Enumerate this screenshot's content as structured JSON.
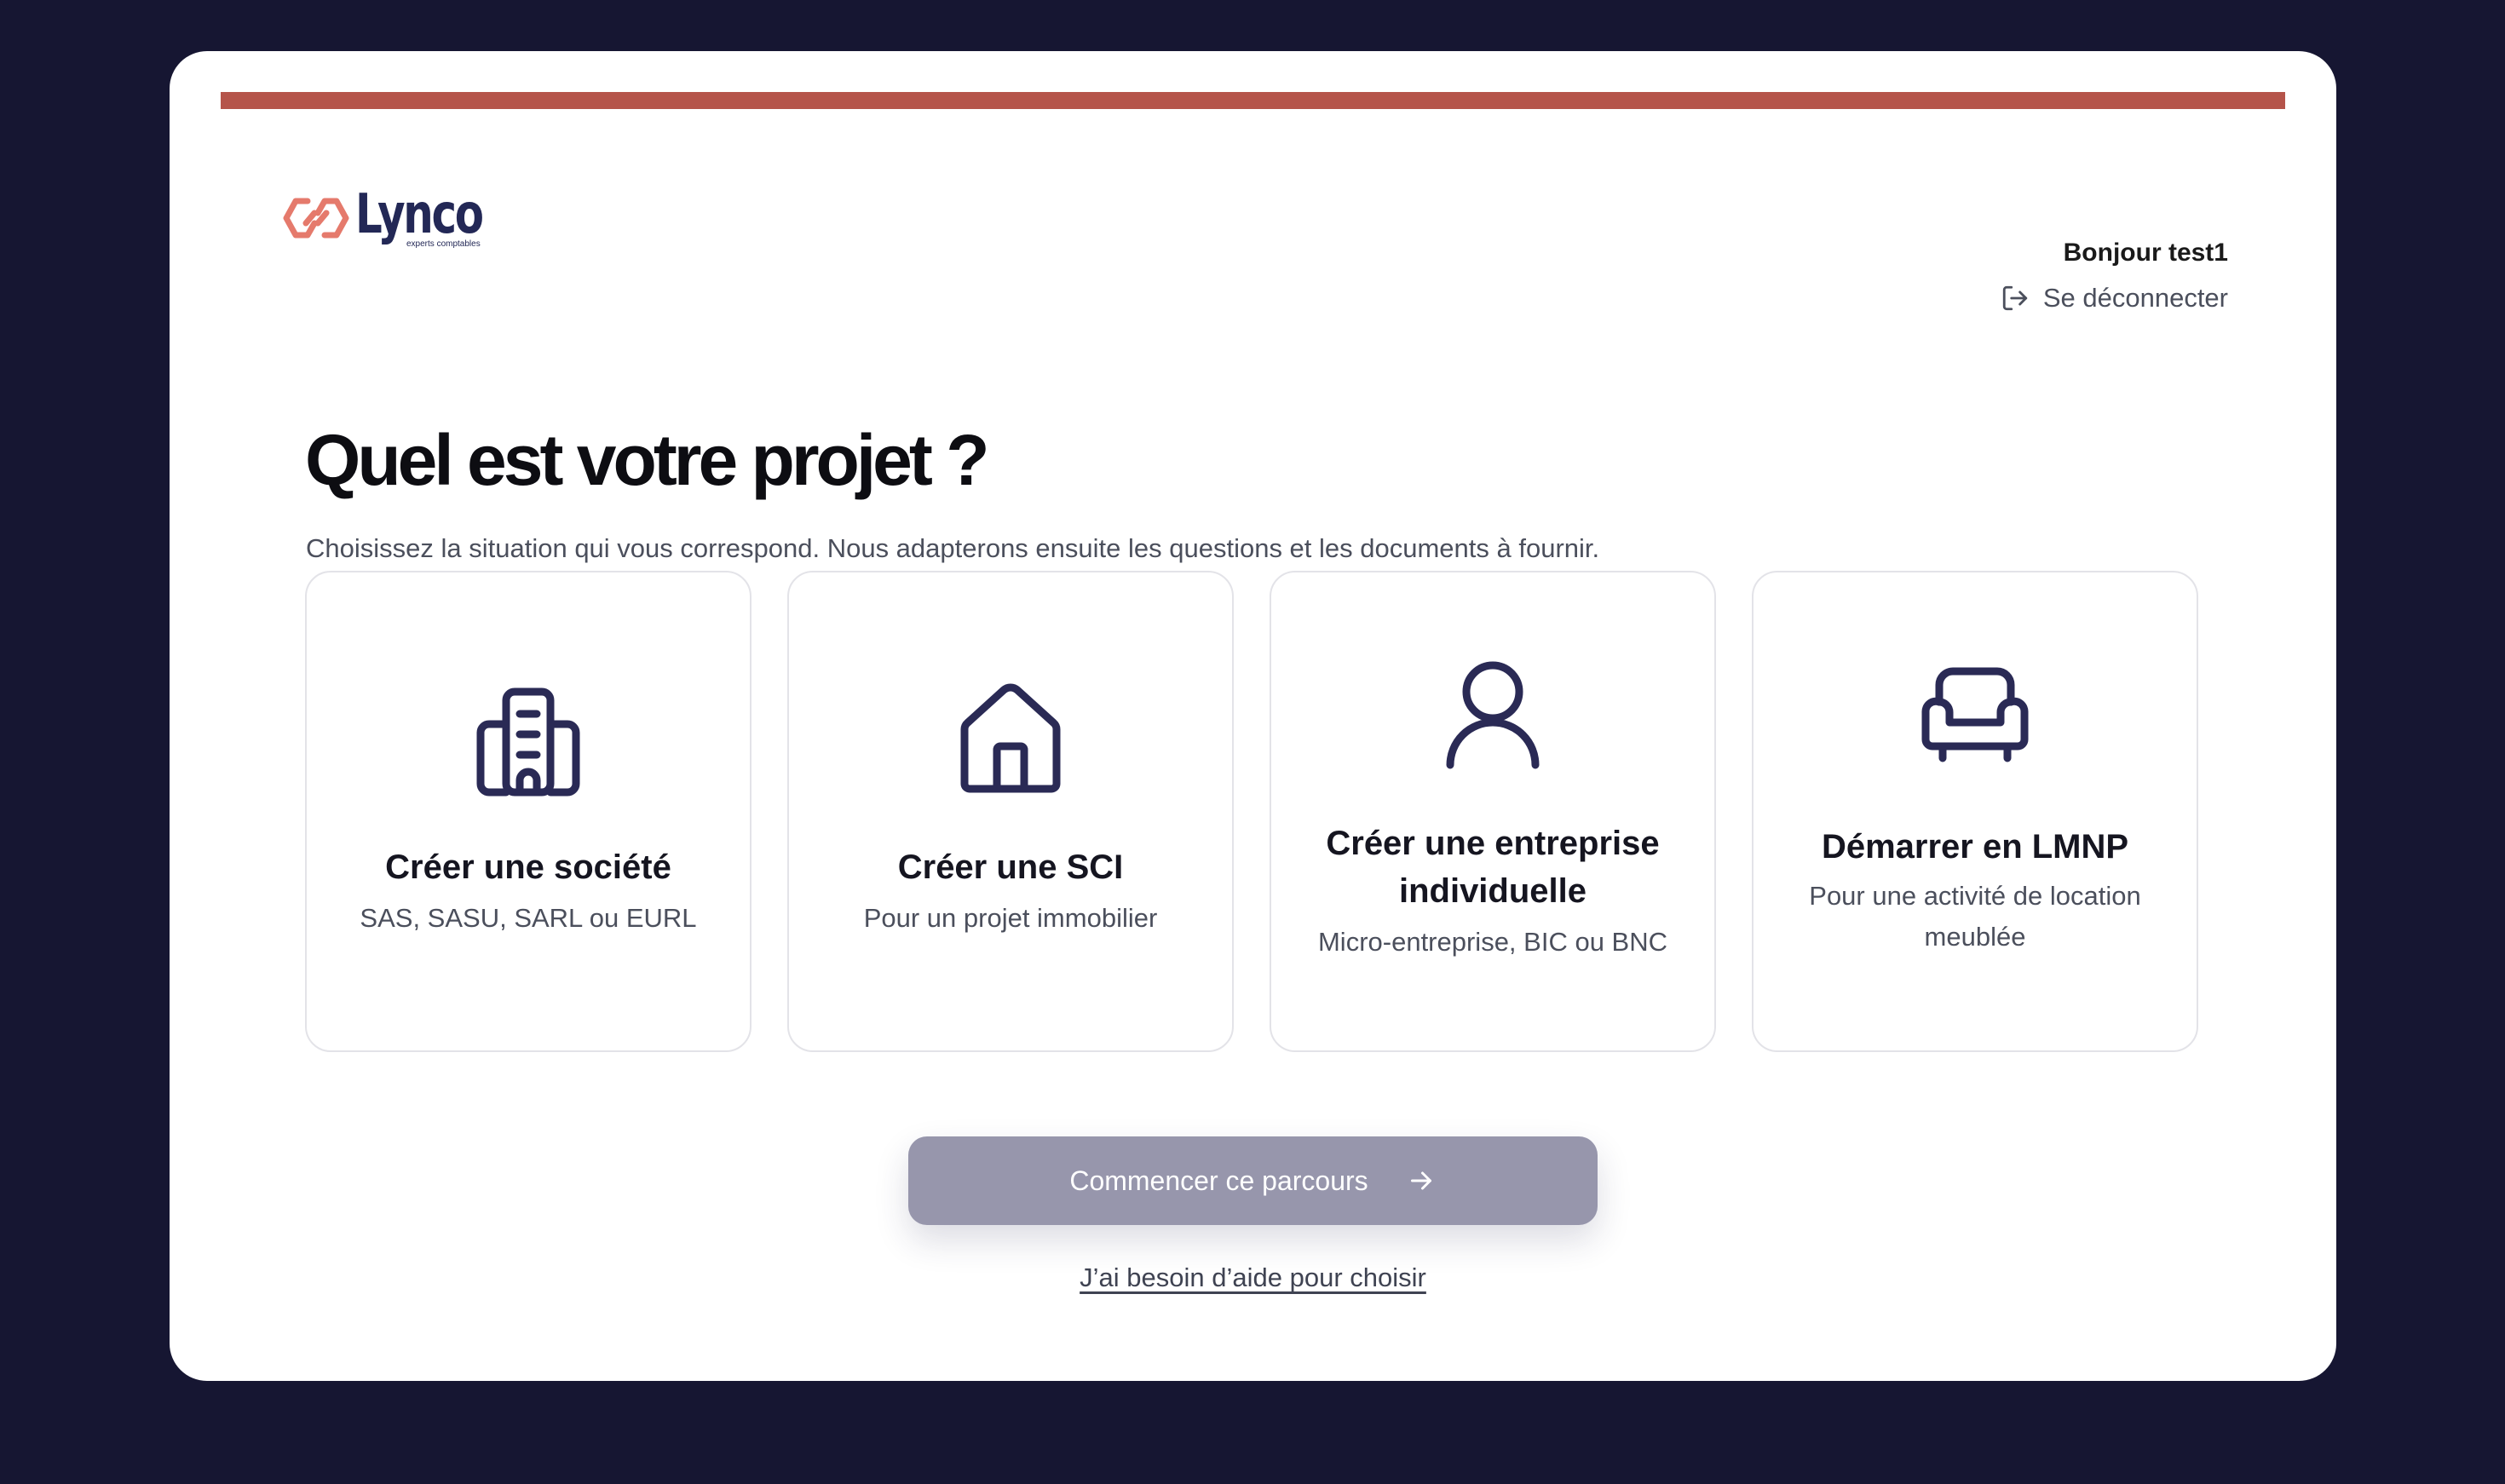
{
  "brand": {
    "name": "Lynco",
    "tagline": "experts comptables",
    "accent_color": "#b5544a",
    "primary_color": "#232856",
    "logo_mark_color": "#e57a6c"
  },
  "header": {
    "greeting": "Bonjour test1",
    "logout_label": "Se déconnecter",
    "logout_icon": "logout-icon"
  },
  "main": {
    "title": "Quel est votre projet ?",
    "subtitle": "Choisissez la situation qui vous correspond. Nous adapterons ensuite les questions et les documents à fournir."
  },
  "options": [
    {
      "title": "Créer une société",
      "description": "SAS, SASU, SARL ou EURL",
      "icon": "building-icon"
    },
    {
      "title": "Créer une SCI",
      "description": "Pour un projet immobilier",
      "icon": "house-icon"
    },
    {
      "title": "Créer une entreprise individuelle",
      "description": "Micro-entreprise, BIC ou BNC",
      "icon": "user-icon"
    },
    {
      "title": "Démarrer en LMNP",
      "description": "Pour une activité de location meublée",
      "icon": "armchair-icon"
    }
  ],
  "actions": {
    "start_label": "Commencer ce parcours",
    "start_icon": "arrow-right-icon",
    "start_disabled_color": "#9796ac",
    "help_label": "J’ai besoin d’aide pour choisir"
  }
}
